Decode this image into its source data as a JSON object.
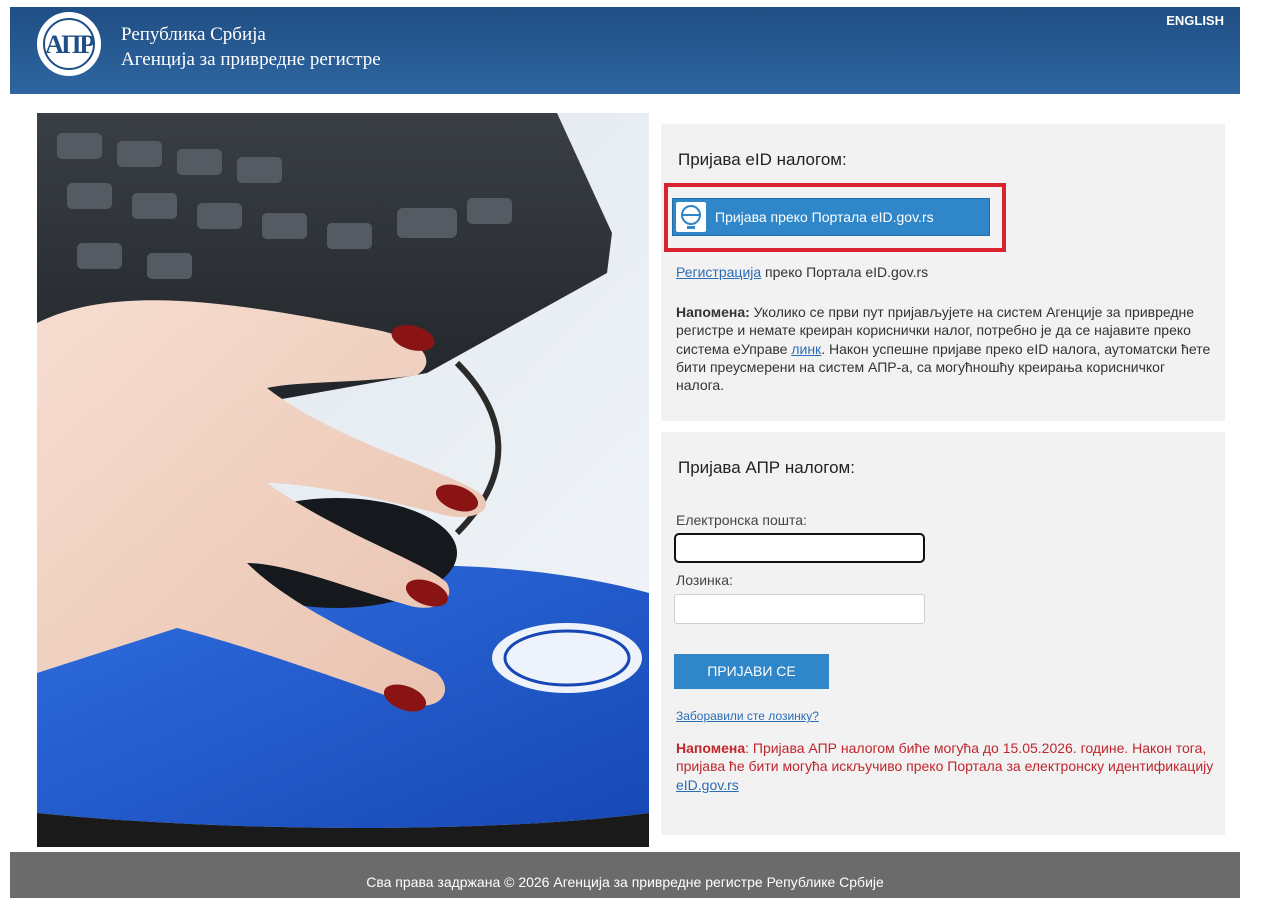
{
  "header": {
    "logo_text": "АПР",
    "org_line1": "Република Србија",
    "org_line2": "Агенција за привредне регистре",
    "language_link": "ENGLISH",
    "background_color": "#2a5d96"
  },
  "eid_panel": {
    "title": "Пријава eID налогом:",
    "button_label": "Пријава преко Портала eID.gov.rs",
    "button_icon": "eid-logo-icon",
    "highlight_color": "#d9232e",
    "register_link": "Регистрација",
    "register_suffix": " преко Портала eID.gov.rs",
    "note_label": "Напомена:",
    "note_text_before": " Уколико се први пут пријављујете на систем Агенције за привредне регистре и немате креиран кориснички налог, потребно је да се најавите преко система еУправе ",
    "note_link": "линк",
    "note_text_after": ". Након успешне пријаве преко eID налога, аутоматски ћете бити преусмерени на систем АПР-а, са могућношћу креирања корисничког налога."
  },
  "apr_panel": {
    "title": "Пријава АПР налогом:",
    "email_label": "Електронска пошта:",
    "email_value": "",
    "password_label": "Лозинка:",
    "password_value": "",
    "login_button": "ПРИЈАВИ СЕ",
    "forgot_link": "Заборавили сте лозинку?",
    "note_label": "Напомена",
    "note_text": ": Пријава АПР налогом биће могућа до 15.05.2026. године. Након тога, пријава ће бити могућа искључиво преко Портала за електронску идентификацију ",
    "note_link": "eID.gov.rs",
    "accent_color": "#2f86c8",
    "note_color": "#c0262d"
  },
  "footer": {
    "text": "Сва права задржана © 2026 Агенција за привредне регистре Републике Србије"
  }
}
